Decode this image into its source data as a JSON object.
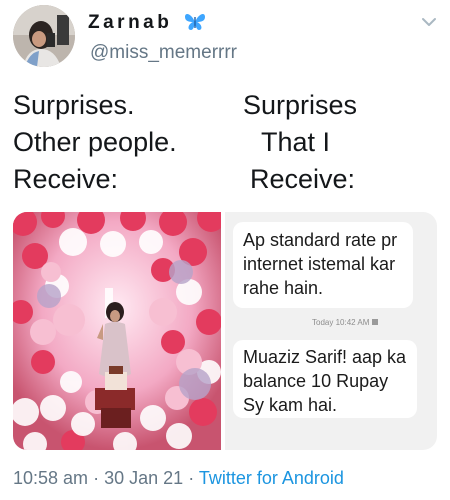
{
  "user": {
    "display_name": "Zarnab",
    "handle": "@miss_memerrrr",
    "name_emoji_icon": "butterfly-icon",
    "menu_icon": "chevron-down-icon"
  },
  "tweet": {
    "left_column": [
      "Surprises.",
      "Other people.",
      "Receive:"
    ],
    "right_column": [
      "Surprises",
      "That I",
      "Receive:"
    ]
  },
  "media": {
    "sms": {
      "message_1": "Ap standard rate pr internet istemal kar rahe hain.",
      "timestamp": "Today 10:42 AM",
      "message_2": "Muaziz Sarif! aap ka balance 10 Rupay Sy kam hai."
    }
  },
  "footer": {
    "time": "10:58 am",
    "separator": "·",
    "date": "30 Jan 21",
    "source": "Twitter for Android"
  },
  "colors": {
    "text": "#14171a",
    "secondary": "#657786",
    "link": "#1b95e0",
    "butterfly": "#3ea6ff"
  }
}
